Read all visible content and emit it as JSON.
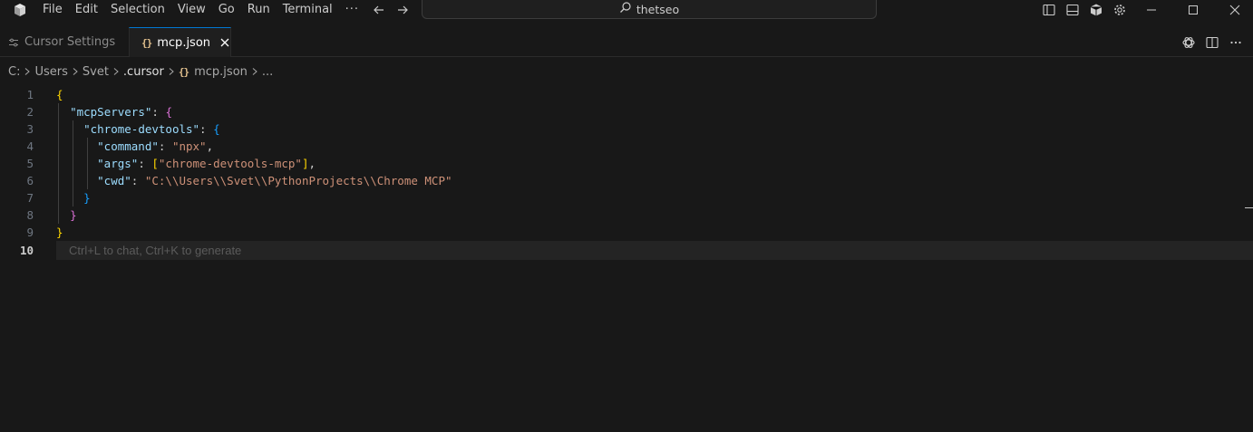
{
  "menu": {
    "items": [
      "File",
      "Edit",
      "Selection",
      "View",
      "Go",
      "Run",
      "Terminal"
    ],
    "more": "···"
  },
  "search": {
    "label": "thetseo"
  },
  "tabs": {
    "inactive": {
      "label": "Cursor Settings"
    },
    "active": {
      "label": "mcp.json",
      "icon": "{}"
    }
  },
  "breadcrumb": {
    "segments": [
      "C:",
      "Users",
      "Svet",
      ".cursor"
    ],
    "file": "mcp.json",
    "file_icon": "{}",
    "more": "..."
  },
  "editor": {
    "current_line": 10,
    "hint": "Ctrl+L to chat, Ctrl+K to generate",
    "lines": [
      {
        "number": "1"
      },
      {
        "number": "2",
        "key": "\"mcpServers\""
      },
      {
        "number": "3",
        "key": "\"chrome-devtools\""
      },
      {
        "number": "4",
        "key": "\"command\"",
        "value": "\"npx\""
      },
      {
        "number": "5",
        "key": "\"args\"",
        "value": "\"chrome-devtools-mcp\""
      },
      {
        "number": "6",
        "key": "\"cwd\"",
        "value": "\"C:\\\\Users\\\\Svet\\\\PythonProjects\\\\Chrome MCP\""
      },
      {
        "number": "7"
      },
      {
        "number": "8"
      },
      {
        "number": "9"
      },
      {
        "number": "10"
      }
    ]
  },
  "colors": {
    "accent": "#0078d4",
    "json_key": "#9cdcfe",
    "json_string": "#ce9178",
    "bracket_level1": "#ffd700",
    "bracket_level2": "#da70d6",
    "bracket_level3": "#179fff"
  },
  "icons": {
    "app": "cursor-logo-icon",
    "back": "arrow-left-icon",
    "forward": "arrow-right-icon",
    "search": "search-icon",
    "toggle_primary_sidebar": "sidebar-left-icon",
    "toggle_panel": "panel-icon",
    "extensions": "cube-icon",
    "settings": "gear-icon",
    "minimize": "minimize-icon",
    "maximize": "maximize-icon",
    "close": "close-icon",
    "settings_tab": "settings-tab-icon",
    "tab_close": "close-icon",
    "openai": "openai-icon",
    "split_editor": "split-editor-icon",
    "more_actions": "ellipsis-icon",
    "chevron": "chevron-right-icon"
  }
}
